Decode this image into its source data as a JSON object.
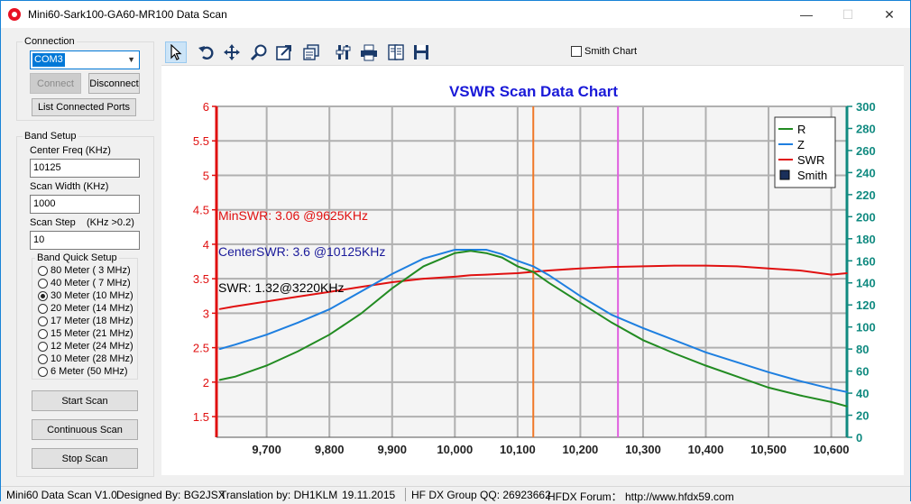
{
  "window": {
    "title": "Mini60-Sark100-GA60-MR100 Data Scan",
    "min": "—",
    "max": "☐",
    "close": "✕"
  },
  "connection": {
    "group_label": "Connection",
    "port": "COM3",
    "connect_label": "Connect",
    "disconnect_label": "Disconnect",
    "list_ports_label": "List Connected Ports"
  },
  "band_setup": {
    "group_label": "Band Setup",
    "center_freq_label": "Center Freq  (KHz)",
    "center_freq": "10125",
    "scan_width_label": "Scan Width   (KHz)",
    "scan_width": "1000",
    "scan_step_label": "Scan Step",
    "scan_step_hint": "(KHz >0.2)",
    "scan_step": "10",
    "quick_label": "Band Quick Setup",
    "bands": [
      {
        "label": "80 Meter (  3 MHz)",
        "checked": false
      },
      {
        "label": "40 Meter (  7 MHz)",
        "checked": false
      },
      {
        "label": "30 Meter (10 MHz)",
        "checked": true
      },
      {
        "label": "20 Meter (14 MHz)",
        "checked": false
      },
      {
        "label": "17 Meter (18 MHz)",
        "checked": false
      },
      {
        "label": "15 Meter (21 MHz)",
        "checked": false
      },
      {
        "label": "12 Meter (24 MHz)",
        "checked": false
      },
      {
        "label": "10 Meter (28 MHz)",
        "checked": false
      },
      {
        "label": "  6 Meter  (50 MHz)",
        "checked": false
      }
    ]
  },
  "actions": {
    "start": "Start Scan",
    "continuous": "Continuous Scan",
    "stop": "Stop Scan"
  },
  "toolbar": {
    "icons": [
      "pointer-icon",
      "undo-icon",
      "move-icon",
      "zoom-icon",
      "export-icon",
      "copy-icon",
      "settings-icon",
      "print-icon",
      "preview-icon",
      "save-icon"
    ],
    "smith_chart_label": "Smith Chart",
    "smith_chart_checked": false
  },
  "status": {
    "version": "Mini60 Data Scan V1.0",
    "designer": "Designed By: BG2JSX",
    "translation": "Translation by: DH1KLM",
    "date": "19.11.2015",
    "qq": "HF DX Group QQ: 26923662",
    "forum": "HFDX Forum：  http://www.hfdx59.com"
  },
  "chart_data": {
    "type": "line",
    "title": "VSWR Scan Data Chart",
    "xlim": [
      9620,
      10625
    ],
    "x_ticks": [
      "9,700",
      "9,800",
      "9,900",
      "10,000",
      "10,100",
      "10,200",
      "10,300",
      "10,400",
      "10,500",
      "10,600"
    ],
    "y_left_lim": [
      1.2,
      6
    ],
    "y_left_ticks": [
      "1.5",
      "2",
      "2.5",
      "3",
      "3.5",
      "4",
      "4.5",
      "5",
      "5.5",
      "6"
    ],
    "y_right_lim": [
      0,
      300
    ],
    "y_right_ticks": [
      "0",
      "20",
      "40",
      "60",
      "80",
      "100",
      "120",
      "140",
      "160",
      "180",
      "200",
      "220",
      "240",
      "260",
      "280",
      "300"
    ],
    "grid": true,
    "legend_position": "top-right",
    "legend": [
      {
        "name": "R",
        "color": "#228b22"
      },
      {
        "name": "Z",
        "color": "#1e7fe0"
      },
      {
        "name": "SWR",
        "color": "#e01010"
      },
      {
        "name": "Smith",
        "color": "#1a2f5a"
      }
    ],
    "annotations": [
      {
        "text": "MinSWR: 3.06 @9625KHz",
        "color": "#e01010"
      },
      {
        "text": "CenterSWR: 3.6 @10125KHz",
        "color": "#1a1a9a"
      },
      {
        "text": "SWR: 1.32@3220KHz",
        "color": "#000000"
      }
    ],
    "markers": [
      {
        "x": 10125,
        "color": "#f07828"
      },
      {
        "x": 10260,
        "color": "#e060e0"
      }
    ],
    "x": [
      9625,
      9650,
      9700,
      9750,
      9800,
      9850,
      9900,
      9950,
      10000,
      10025,
      10050,
      10075,
      10100,
      10125,
      10150,
      10200,
      10250,
      10300,
      10350,
      10400,
      10450,
      10500,
      10550,
      10600,
      10625
    ],
    "series": [
      {
        "name": "SWR",
        "axis": "left",
        "color": "#e01010",
        "values": [
          3.06,
          3.1,
          3.17,
          3.24,
          3.31,
          3.38,
          3.45,
          3.5,
          3.53,
          3.55,
          3.56,
          3.57,
          3.58,
          3.6,
          3.62,
          3.65,
          3.67,
          3.68,
          3.69,
          3.69,
          3.68,
          3.65,
          3.62,
          3.56,
          3.58
        ]
      },
      {
        "name": "Z",
        "axis": "right",
        "color": "#1e7fe0",
        "values": [
          80,
          84,
          93,
          104,
          116,
          132,
          148,
          162,
          170,
          170,
          170,
          166,
          160,
          155,
          147,
          128,
          111,
          99,
          88,
          77,
          68,
          59,
          51,
          44,
          41
        ]
      },
      {
        "name": "R",
        "axis": "right",
        "color": "#228b22",
        "values": [
          52,
          55,
          65,
          78,
          93,
          112,
          135,
          155,
          167,
          169,
          167,
          163,
          155,
          150,
          140,
          122,
          104,
          88,
          76,
          65,
          55,
          45,
          38,
          32,
          28
        ]
      }
    ]
  }
}
